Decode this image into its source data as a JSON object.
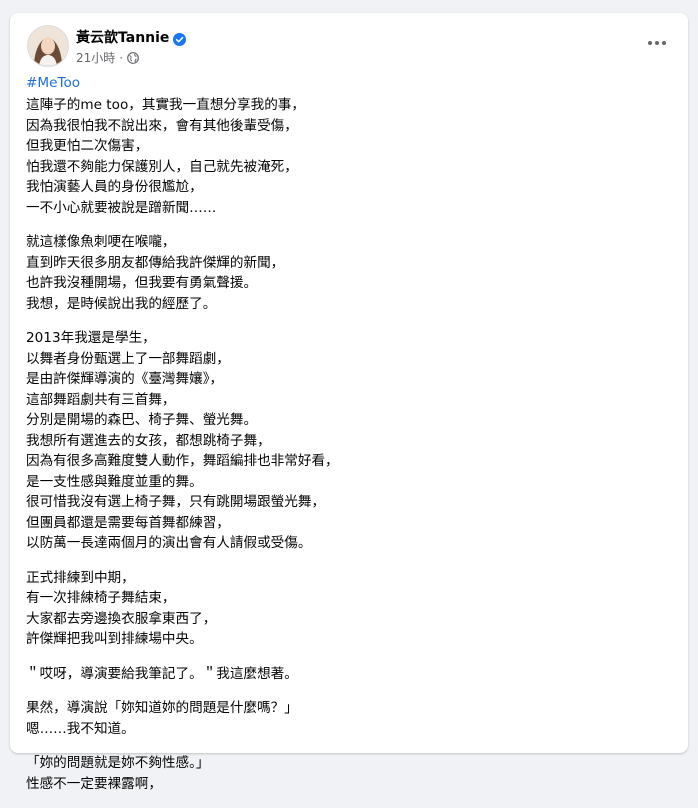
{
  "post": {
    "author": "黃云歆Tannie",
    "time": "21小時",
    "dot": "·",
    "hashtag": "#MeToo",
    "paragraphs": [
      [
        "這陣子的me too，其實我一直想分享我的事，",
        "因為我很怕我不說出來，會有其他後輩受傷，",
        "但我更怕二次傷害，",
        "怕我還不夠能力保護別人，自己就先被淹死，",
        "我怕演藝人員的身份很尷尬，",
        "一不小心就要被說是蹭新聞……"
      ],
      [
        "就這樣像魚刺哽在喉嚨，",
        "直到昨天很多朋友都傳給我許傑輝的新聞，",
        "也許我沒種開場，但我要有勇氣聲援。",
        "我想，是時候說出我的經歷了。"
      ],
      [
        "2013年我還是學生，",
        "以舞者身份甄選上了一部舞蹈劇，",
        "是由許傑輝導演的《臺灣舞孃》，",
        "這部舞蹈劇共有三首舞，",
        "分別是開場的森巴、椅子舞、螢光舞。",
        "我想所有選進去的女孩，都想跳椅子舞，",
        "因為有很多高難度雙人動作，舞蹈編排也非常好看，",
        "是一支性感與難度並重的舞。",
        "很可惜我沒有選上椅子舞，只有跳開場跟螢光舞，",
        "但團員都還是需要每首舞都練習，",
        "以防萬一長達兩個月的演出會有人請假或受傷。"
      ],
      [
        "正式排練到中期，",
        "有一次排練椅子舞結束，",
        "大家都去旁邊換衣服拿東西了，",
        "許傑輝把我叫到排練場中央。"
      ],
      [
        "＂哎呀，導演要給我筆記了。＂我這麼想著。"
      ],
      [
        "果然，導演說「妳知道妳的問題是什麼嗎？」",
        "嗯……我不知道。"
      ],
      [
        "「妳的問題就是妳不夠性感。」",
        "性感不一定要裸露啊，"
      ]
    ]
  },
  "colors": {
    "link": "#216fdb",
    "verified": "#1877f2",
    "text": "#050505",
    "meta": "#65676b"
  },
  "icons": [
    "verified-badge-icon",
    "globe-icon",
    "more-options-icon"
  ]
}
